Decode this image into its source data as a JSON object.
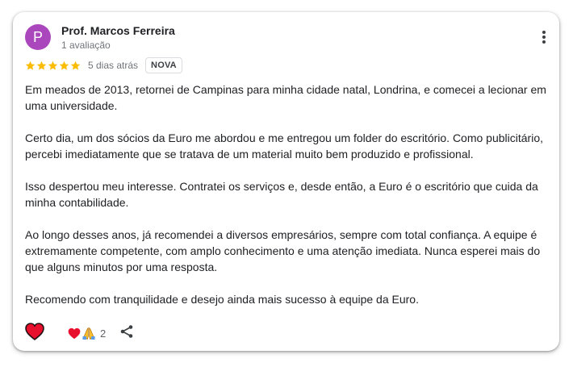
{
  "review": {
    "author": {
      "initial": "P",
      "name": "Prof. Marcos Ferreira",
      "meta": "1 avaliação",
      "avatar_color": "#ab47bc"
    },
    "rating": 5,
    "date": "5 dias atrás",
    "badge": "NOVA",
    "star_color": "#fbbc04",
    "paragraphs": [
      "Em meados de 2013, retornei de Campinas para minha cidade natal, Londrina, e comecei a lecionar em uma universidade.",
      "Certo dia, um dos sócios da Euro me abordou e me entregou um folder do escritório. Como publicitário, percebi imediatamente que se tratava de um material muito bem produzido e profissional.",
      "Isso despertou meu interesse. Contratei os serviços e, desde então, a Euro é o escritório que cuida da minha contabilidade.",
      "Ao longo desses anos, já recomendei a diversos empresários, sempre com total confiança. A equipe é extremamente competente, com amplo conhecimento e uma atenção imediata. Nunca esperei mais do que alguns minutos por uma resposta.",
      "Recomendo com tranquilidade e desejo ainda mais sucesso à equipe da Euro."
    ],
    "reactions": {
      "icons": [
        "heart-icon",
        "folded-hands-icon"
      ],
      "count": "2"
    },
    "actions": [
      "heart-like-icon",
      "more-vert-icon",
      "share-icon"
    ],
    "heart_color": "#e8112d"
  }
}
